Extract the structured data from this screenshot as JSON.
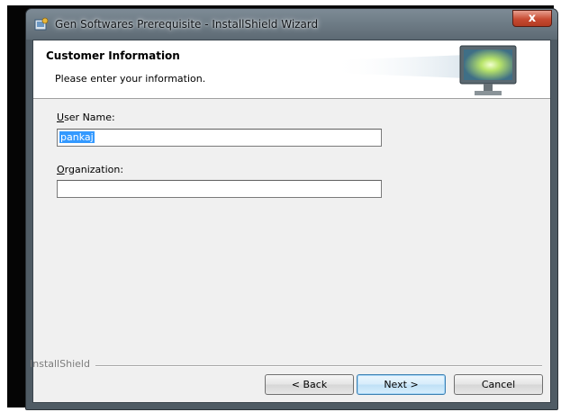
{
  "window": {
    "title": "Gen Softwares Prerequisite - InstallShield Wizard",
    "close_glyph": "x"
  },
  "banner": {
    "title": "Customer Information",
    "subtitle": "Please enter your information."
  },
  "form": {
    "user_name": {
      "label_accel": "U",
      "label_rest": "ser Name:",
      "value": "pankaj"
    },
    "organization": {
      "label_accel": "O",
      "label_rest": "rganization:",
      "value": ""
    }
  },
  "footer": {
    "brand": "InstallShield"
  },
  "buttons": {
    "back": "< Back",
    "next": "Next >",
    "cancel": "Cancel"
  },
  "icons": {
    "title_icon": "installshield-setup-icon",
    "banner_icon": "computer-monitor-icon"
  }
}
